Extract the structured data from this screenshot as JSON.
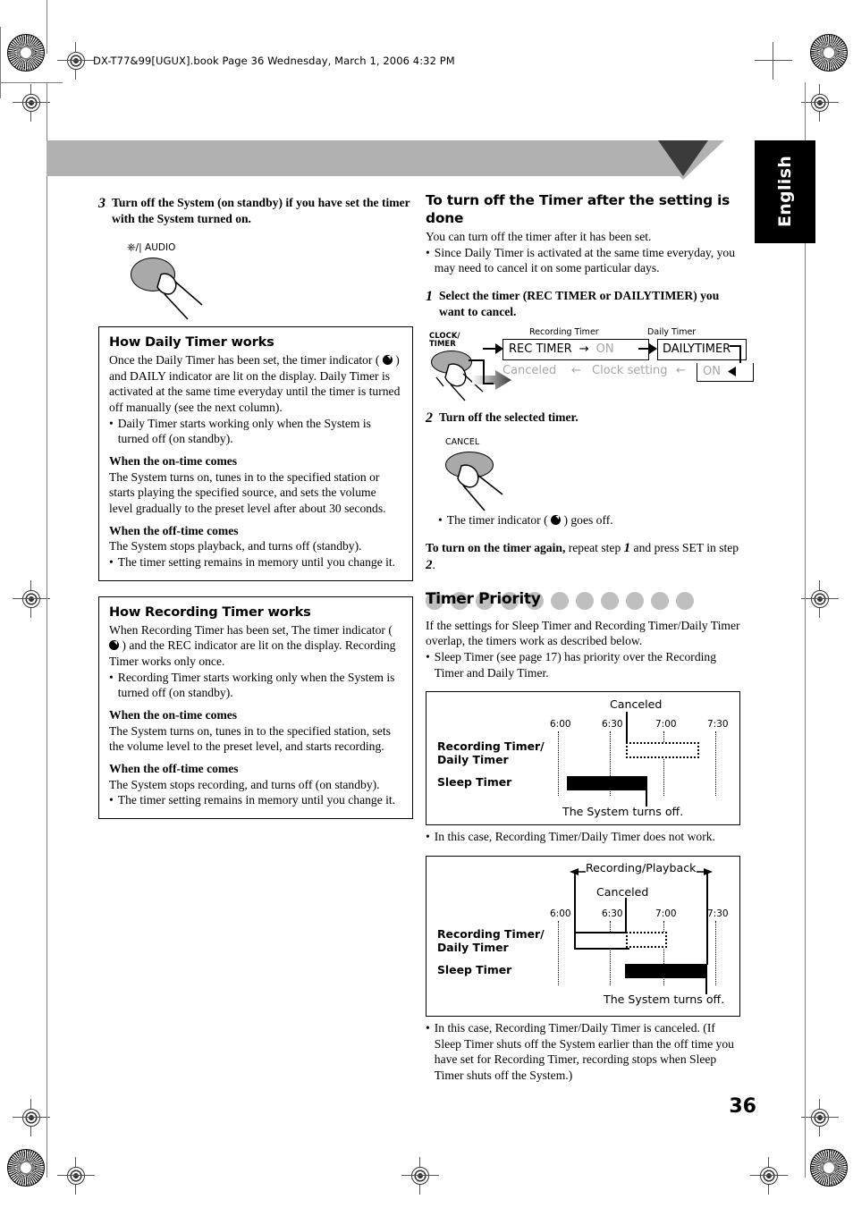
{
  "header": {
    "file_info": "DX-T77&99[UGUX].book  Page 36  Wednesday, March 1, 2006  4:32 PM"
  },
  "tab": {
    "language": "English"
  },
  "page_number": "36",
  "left_column": {
    "step3": {
      "number": "3",
      "text": "Turn off the System (on standby) if you have set the timer with the System turned on."
    },
    "power_button_label": "/| AUDIO",
    "daily_box": {
      "title": "How Daily Timer works",
      "p1_a": "Once the Daily Timer has been set, the timer indicator",
      "p1_b": ") and DAILY indicator are lit on the display. Daily Timer is activated at the same time everyday until the timer is turned off manually (see the next column).",
      "bullet1": "Daily Timer starts working only when the System is turned off (on standby).",
      "on_time_head": "When the on-time comes",
      "on_time_text": "The System turns on, tunes in to the specified station or starts playing the specified source, and sets the volume level gradually to the preset level after about 30 seconds.",
      "off_time_head": "When the off-time comes",
      "off_time_text": "The System stops playback, and turns off (standby).",
      "bullet2": "The timer setting remains in memory until you change it."
    },
    "recording_box": {
      "title": "How Recording Timer works",
      "p1_a": "When Recording Timer has been set, The timer indicator",
      "p1_b": ") and the REC indicator are lit on the display. Recording Timer works only once.",
      "bullet1": "Recording Timer starts working only when the System is turned off (on standby).",
      "on_time_head": "When the on-time comes",
      "on_time_text": "The System turns on, tunes in to the specified station, sets the volume level to the preset level, and starts recording.",
      "off_time_head": "When the off-time comes",
      "off_time_text": "The System stops recording, and turns off (on standby).",
      "bullet2": "The timer setting remains in memory until you change it."
    }
  },
  "right_column": {
    "section1": {
      "heading": "To turn off the Timer after the setting is done",
      "intro": "You can turn off the timer after it has been set.",
      "bullet": "Since Daily Timer is activated at the same time everyday, you may need to cancel it on some particular days.",
      "step1": {
        "number": "1",
        "text": "Select the timer (REC TIMER or DAILYTIMER) you want to cancel."
      },
      "flow": {
        "button_label_l1": "CLOCK/",
        "button_label_l2": "TIMER",
        "caption_rec": "Recording Timer",
        "caption_daily": "Daily Timer",
        "box1_text": "REC TIMER",
        "box1_arrow": "→",
        "box1_on": "ON",
        "box2_text": "DAILYTIMER",
        "box2_on": "ON",
        "canceled": "Canceled",
        "arrow_left1": "←",
        "clock_setting": "Clock setting",
        "arrow_left2": "←"
      },
      "step2": {
        "number": "2",
        "text": "Turn off the selected timer."
      },
      "cancel_button_label": "CANCEL",
      "step2_bullet_a": "The timer indicator (",
      "step2_bullet_b": ") goes off.",
      "turn_on_again_bold": "To turn on the timer again,",
      "turn_on_again_a": " repeat step ",
      "turn_on_again_num1": "1",
      "turn_on_again_b": " and press SET in step ",
      "turn_on_again_num2": "2",
      "turn_on_again_c": "."
    },
    "timer_priority": {
      "heading": "Timer Priority",
      "intro": "If the settings for Sleep Timer and Recording Timer/Daily Timer overlap, the timers work as described below.",
      "bullet": "Sleep Timer (see page 17) has priority over the Recording Timer and Daily Timer.",
      "note1": "In this case, Recording Timer/Daily Timer does not work.",
      "note2": "In this case, Recording Timer/Daily Timer is canceled. (If Sleep Timer shuts off the System earlier than the off time you have set for Recording Timer, recording stops when Sleep Timer shuts off the System.)"
    }
  },
  "chart_data": [
    {
      "type": "timeline",
      "title": "Timer priority case 1 - Sleep Timer shuts system off before Recording/Daily Timer starts",
      "ticks": [
        "6:00",
        "6:30",
        "7:00",
        "7:30"
      ],
      "row_labels": [
        "Recording Timer/ Daily Timer",
        "Sleep Timer"
      ],
      "annotations": [
        "Canceled",
        "The System turns off."
      ],
      "series": [
        {
          "name": "Recording Timer/Daily Timer",
          "style": "dotted",
          "start": "6:45",
          "end": "7:15"
        },
        {
          "name": "Sleep Timer",
          "style": "solid-filled",
          "start": "6:10",
          "end": "6:45"
        }
      ]
    },
    {
      "type": "timeline",
      "title": "Timer priority case 2 - Recording/Playback canceled when Sleep Timer shuts system off",
      "ticks": [
        "6:00",
        "6:30",
        "7:00",
        "7:30"
      ],
      "row_labels": [
        "Recording Timer/ Daily Timer",
        "Sleep Timer"
      ],
      "annotations": [
        "Recording/Playback",
        "Canceled",
        "The System turns off."
      ],
      "series": [
        {
          "name": "Recording Timer/Daily Timer",
          "style": "open-then-dotted",
          "start": "6:05",
          "switch": "6:35",
          "end": "7:05"
        },
        {
          "name": "Sleep Timer",
          "style": "solid-filled",
          "start": "6:40",
          "end": "7:30"
        }
      ]
    }
  ]
}
